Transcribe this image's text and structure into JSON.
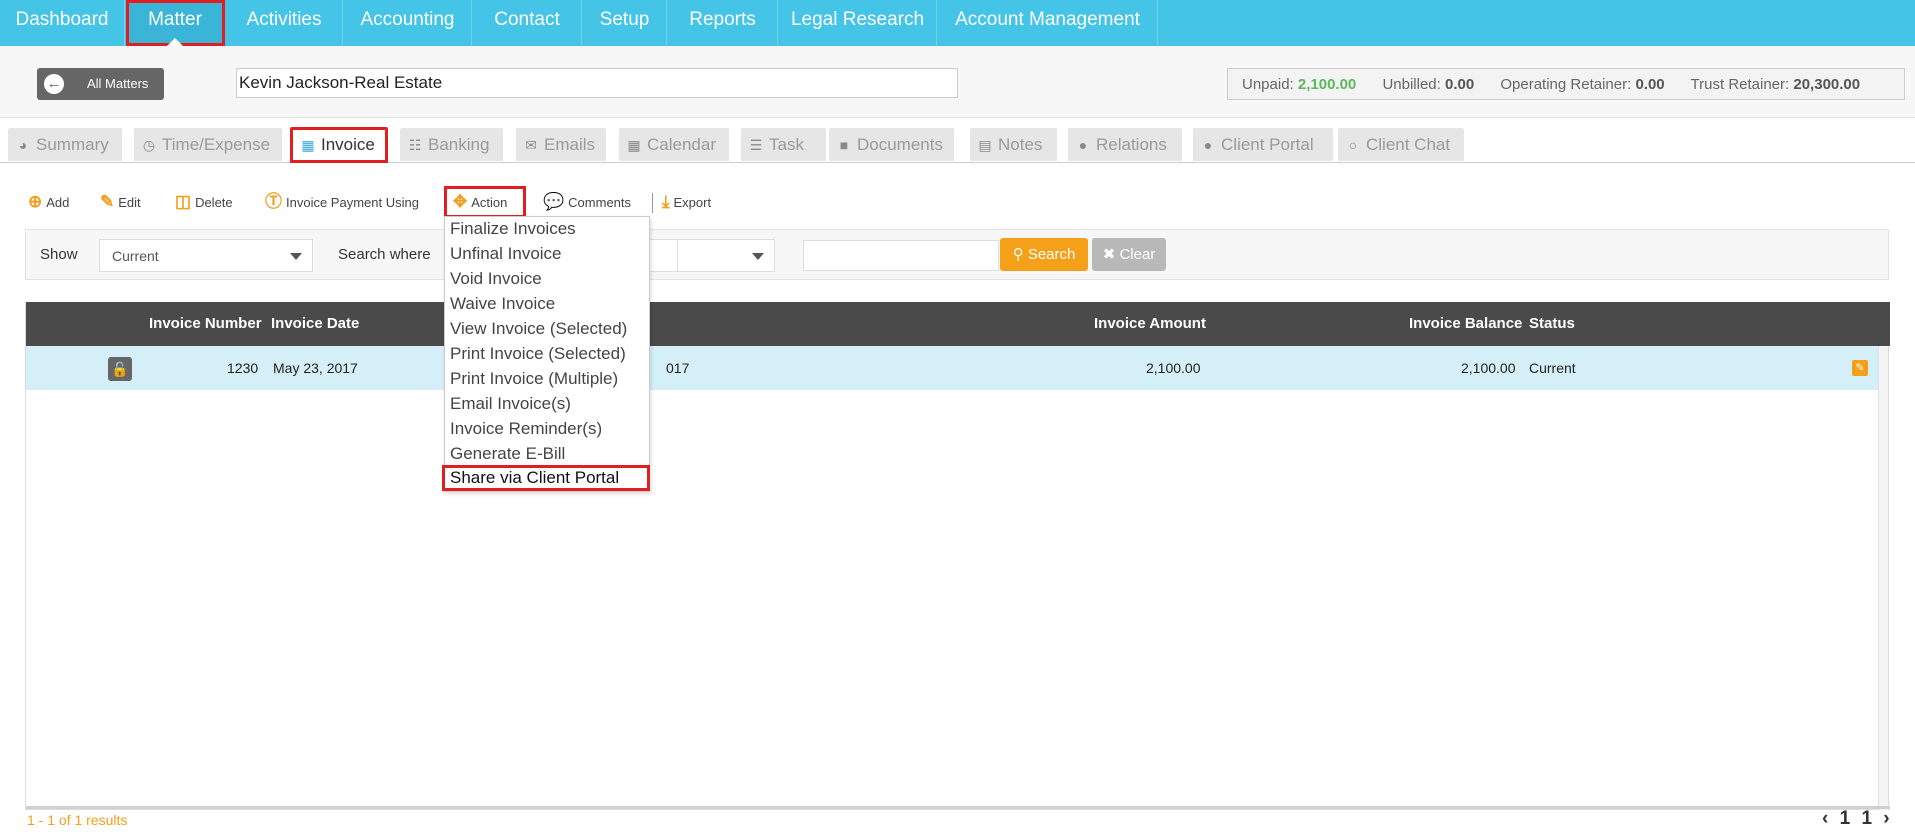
{
  "nav": {
    "items": [
      {
        "label": "Dashboard"
      },
      {
        "label": "Matter"
      },
      {
        "label": "Activities"
      },
      {
        "label": "Accounting"
      },
      {
        "label": "Contact"
      },
      {
        "label": "Setup"
      },
      {
        "label": "Reports"
      },
      {
        "label": "Legal Research"
      },
      {
        "label": "Account Management"
      }
    ],
    "active": "Matter"
  },
  "matter": {
    "all_matters_label": "All Matters",
    "name": "Kevin Jackson-Real Estate",
    "unpaid_label": "Unpaid:",
    "unpaid_value": "2,100.00",
    "unbilled_label": "Unbilled:",
    "unbilled_value": "0.00",
    "operating_label": "Operating Retainer:",
    "operating_value": "0.00",
    "trust_label": "Trust Retainer:",
    "trust_value": "20,300.00"
  },
  "tabs": [
    {
      "label": "Summary",
      "icon": "dashboard-icon"
    },
    {
      "label": "Time/Expense",
      "icon": "clock-icon"
    },
    {
      "label": "Invoice",
      "icon": "calculator-icon"
    },
    {
      "label": "Banking",
      "icon": "bank-icon"
    },
    {
      "label": "Emails",
      "icon": "envelope-icon"
    },
    {
      "label": "Calendar",
      "icon": "calendar-icon"
    },
    {
      "label": "Task",
      "icon": "tasks-icon"
    },
    {
      "label": "Documents",
      "icon": "folder-icon"
    },
    {
      "label": "Notes",
      "icon": "file-icon"
    },
    {
      "label": "Relations",
      "icon": "users-icon"
    },
    {
      "label": "Client Portal",
      "icon": "user-lock-icon"
    },
    {
      "label": "Client Chat",
      "icon": "chat-icon"
    }
  ],
  "toolbar": {
    "add": "Add",
    "edit": "Edit",
    "delete": "Delete",
    "payment": "Invoice Payment Using",
    "action": "Action",
    "comments": "Comments",
    "export": "Export"
  },
  "filter": {
    "show_label": "Show",
    "show_value": "Current",
    "search_where_label": "Search where",
    "search_button": "Search",
    "clear_button": "Clear"
  },
  "table": {
    "columns": {
      "invoice_number": "Invoice Number",
      "invoice_date": "Invoice Date",
      "invoice_amount": "Invoice Amount",
      "invoice_balance": "Invoice Balance",
      "status": "Status"
    },
    "rows": [
      {
        "invoice_number": "1230",
        "invoice_date": "May 23, 2017",
        "hidden_date_fragment": "017",
        "invoice_amount": "2,100.00",
        "invoice_balance": "2,100.00",
        "status": "Current"
      }
    ]
  },
  "footer": {
    "results": "1 - 1 of 1 results",
    "pager": "‹ 1 1 ›"
  },
  "action_menu": {
    "items": [
      "Finalize Invoices",
      "Unfinal Invoice",
      "Void Invoice",
      "Waive Invoice",
      "View Invoice (Selected)",
      "Print Invoice (Selected)",
      "Print Invoice (Multiple)",
      "Email Invoice(s)",
      "Invoice Reminder(s)",
      "Generate E-Bill",
      "Share via Client Portal"
    ],
    "highlighted": "Share via Client Portal"
  },
  "colors": {
    "nav": "#44c4e6",
    "accent": "#f4a019",
    "highlight": "#e02020",
    "row": "#d5eff8",
    "header": "#4a4a4a",
    "unpaid": "#5cb85c"
  }
}
